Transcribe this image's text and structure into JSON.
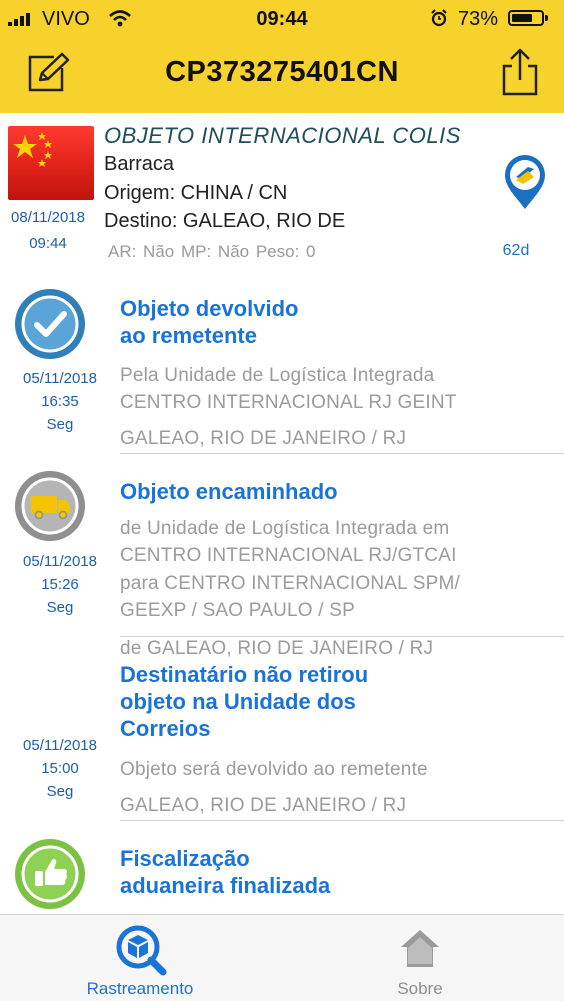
{
  "status_bar": {
    "carrier": "VIVO",
    "time": "09:44",
    "battery_percent": "73%",
    "battery_level": 0.73
  },
  "nav": {
    "title": "CP373275401CN",
    "left_icon": "edit-icon",
    "right_icon": "share-icon"
  },
  "shipment": {
    "flag": "china-flag",
    "type": "OBJETO INTERNACIONAL COLIS",
    "description": "Barraca",
    "origin": "Origem: CHINA / CN",
    "destination": "Destino: GALEAO, RIO DE",
    "details": "AR: Não  MP: Não  Peso: 0",
    "date": "08/11/2018",
    "time": "09:44",
    "age": "62d"
  },
  "events": [
    {
      "icon": "check-circle-icon",
      "title": [
        "Objeto devolvido",
        "ao remetente"
      ],
      "lines": [
        "Pela Unidade de Logística Integrada",
        "CENTRO INTERNACIONAL RJ GEINT",
        "GALEAO, RIO DE JANEIRO / RJ"
      ],
      "date": "05/11/2018",
      "time": "16:35",
      "weekday": "Seg"
    },
    {
      "icon": "truck-icon",
      "title": [
        "Objeto encaminhado"
      ],
      "lines": [
        "de Unidade de Logística Integrada em",
        "CENTRO INTERNACIONAL RJ/GTCAI",
        "para CENTRO INTERNACIONAL SPM/",
        "GEEXP / SAO PAULO / SP",
        "de GALEAO, RIO DE JANEIRO / RJ"
      ],
      "date": "05/11/2018",
      "time": "15:26",
      "weekday": "Seg"
    },
    {
      "icon": "",
      "title": [
        "Destinatário não retirou",
        "objeto na Unidade dos",
        "Correios"
      ],
      "lines": [
        "Objeto será devolvido ao remetente",
        "GALEAO, RIO DE JANEIRO / RJ"
      ],
      "date": "05/11/2018",
      "time": "15:00",
      "weekday": "Seg"
    },
    {
      "icon": "thumbs-up-icon",
      "title": [
        "Fiscalização",
        "aduaneira finalizada"
      ],
      "lines": [],
      "date": "",
      "time": "",
      "weekday": ""
    }
  ],
  "tabs": [
    {
      "label": "Rastreamento",
      "icon": "package-search-icon",
      "active": true
    },
    {
      "label": "Sobre",
      "icon": "house-icon",
      "active": false
    }
  ],
  "colors": {
    "header": "#f7d22d",
    "accent_blue": "#1a73d6",
    "event_blue": "#2f7fb9",
    "event_gray": "#8f8f8f",
    "event_green": "#7cc242"
  }
}
